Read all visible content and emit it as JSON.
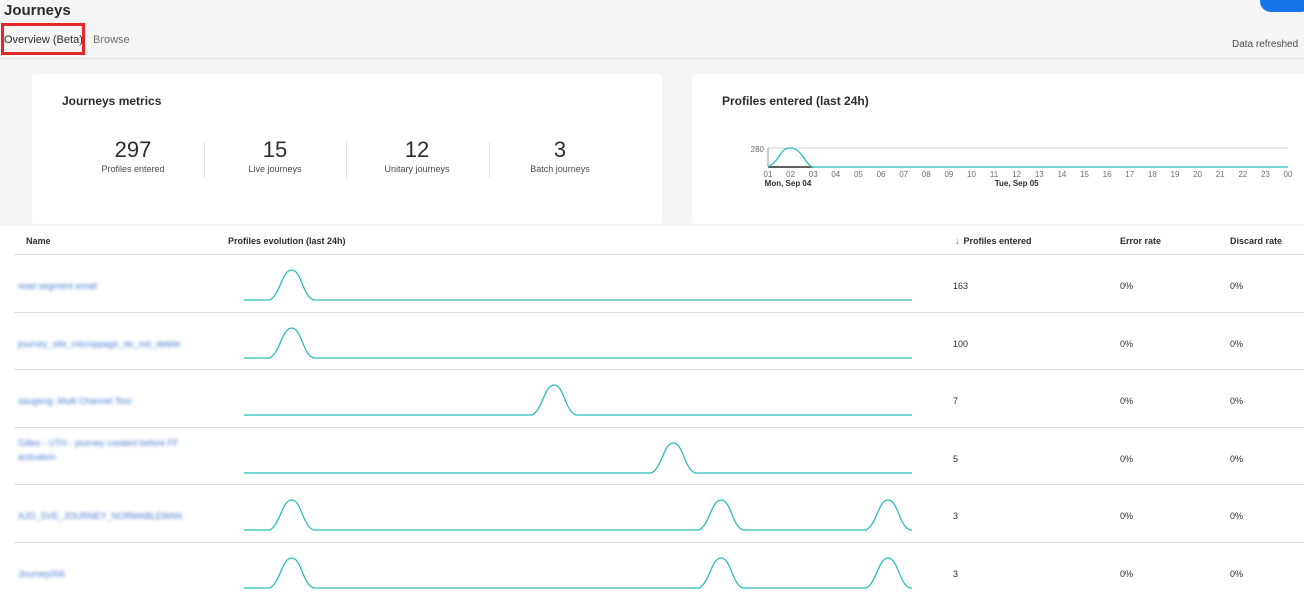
{
  "header": {
    "title": "Journeys",
    "tabs": [
      {
        "label": "Overview (Beta)",
        "active": true
      },
      {
        "label": "Browse",
        "active": false
      }
    ],
    "data_refreshed": "Data refreshed"
  },
  "metrics": {
    "title": "Journeys metrics",
    "items": [
      {
        "value": "297",
        "label": "Profiles entered"
      },
      {
        "value": "15",
        "label": "Live journeys"
      },
      {
        "value": "12",
        "label": "Unitary journeys"
      },
      {
        "value": "3",
        "label": "Batch journeys"
      }
    ]
  },
  "chart_data": {
    "type": "line",
    "title": "Profiles entered (last 24h)",
    "y_tick": "280",
    "x": [
      "01",
      "02",
      "03",
      "04",
      "05",
      "06",
      "07",
      "08",
      "09",
      "10",
      "11",
      "12",
      "13",
      "14",
      "15",
      "16",
      "17",
      "18",
      "19",
      "20",
      "21",
      "22",
      "23",
      "00"
    ],
    "date_labels": [
      "Mon, Sep 04",
      "Tue, Sep 05"
    ],
    "series": [
      {
        "values": [
          0,
          280,
          0,
          0,
          0,
          0,
          0,
          0,
          0,
          0,
          0,
          0,
          0,
          0,
          0,
          0,
          0,
          0,
          0,
          0,
          0,
          0,
          0,
          0
        ]
      }
    ]
  },
  "table": {
    "columns": {
      "name": "Name",
      "evolution": "Profiles evolution (last 24h)",
      "sort_arrow": "↓",
      "profiles": "Profiles entered",
      "error": "Error rate",
      "discard": "Discard rate"
    },
    "rows": [
      {
        "name": "read segment email",
        "profiles": "163",
        "error": "0%",
        "discard": "0%",
        "peaks_hour": [
          2
        ]
      },
      {
        "name": "journey_site_microppage_do_not_delete",
        "profiles": "100",
        "error": "0%",
        "discard": "0%",
        "peaks_hour": [
          2
        ]
      },
      {
        "name": "saugeng: Multi Channel Test",
        "profiles": "7",
        "error": "0%",
        "discard": "0%",
        "peaks_hour": [
          13
        ]
      },
      {
        "name": "Gilles - UTH - journey created before FF activation",
        "profiles": "5",
        "error": "0%",
        "discard": "0%",
        "peaks_hour": [
          18
        ]
      },
      {
        "name": "AJO_SVE_JOURNEY_NORMABLEMAN",
        "profiles": "3",
        "error": "0%",
        "discard": "0%",
        "peaks_hour": [
          2,
          20,
          27
        ]
      },
      {
        "name": "Journey006",
        "profiles": "3",
        "error": "0%",
        "discard": "0%",
        "peaks_hour": [
          2,
          20,
          27
        ]
      }
    ]
  },
  "colors": {
    "accent": "#1473e6",
    "line": "#2bbcbc",
    "highlight": "#e3262a",
    "link": "#4a7bd0"
  }
}
